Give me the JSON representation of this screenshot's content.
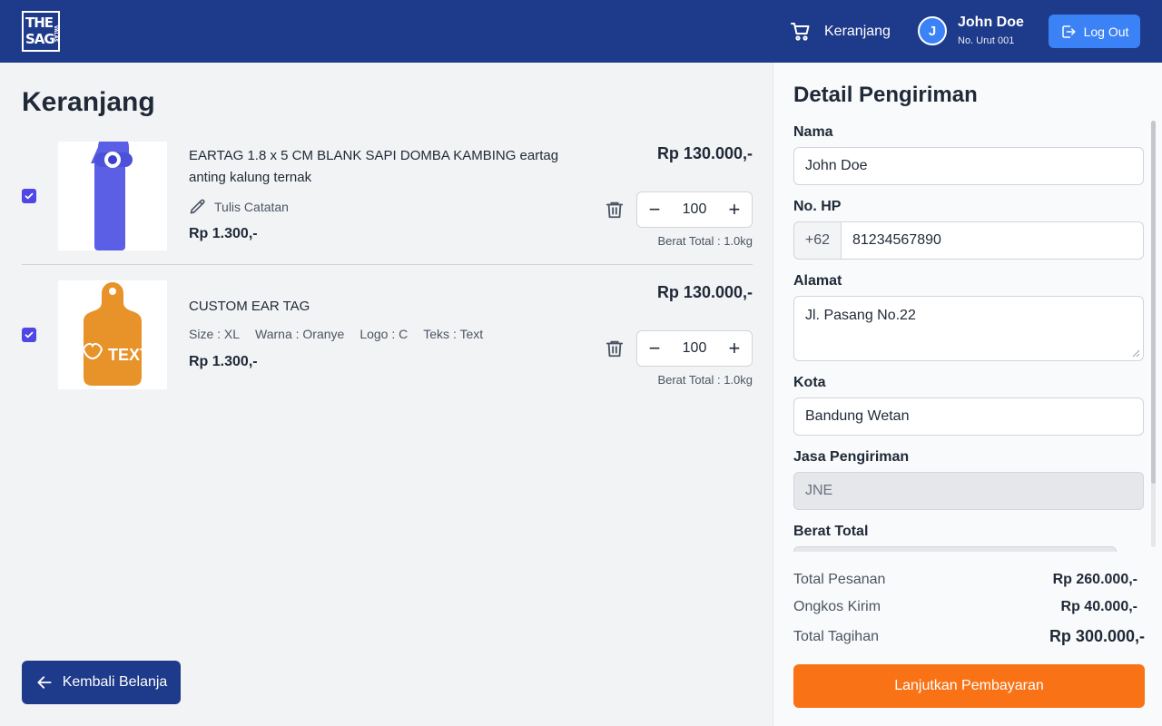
{
  "header": {
    "logo_line1": "THE",
    "logo_line2": "SAG",
    "logo_small": "VALAS",
    "cart_label": "Keranjang",
    "user_initial": "J",
    "user_name": "John Doe",
    "user_sub": "No. Urut 001",
    "logout_label": "Log Out"
  },
  "cart": {
    "title": "Keranjang",
    "items": [
      {
        "name": "EARTAG 1.8 x 5 CM BLANK SAPI DOMBA KAMBING eartag anting kalung ternak",
        "note_label": "Tulis Catatan",
        "unit_price": "Rp 1.300,-",
        "total_price": "Rp 130.000,-",
        "quantity": "100",
        "weight": "Berat Total : 1.0kg",
        "checked": true,
        "image_color": "#5b5fe6"
      },
      {
        "name": "CUSTOM EAR TAG",
        "variants": [
          "Size : XL",
          "Warna : Oranye",
          "Logo : C",
          "Teks : Text"
        ],
        "unit_price": "Rp 1.300,-",
        "total_price": "Rp 130.000,-",
        "quantity": "100",
        "weight": "Berat Total : 1.0kg",
        "checked": true,
        "image_color": "#e8922a",
        "image_text": "TEXT"
      }
    ],
    "back_label": "Kembali Belanja"
  },
  "shipping": {
    "title": "Detail Pengiriman",
    "name_label": "Nama",
    "name_value": "John Doe",
    "phone_label": "No. HP",
    "phone_prefix": "+62",
    "phone_value": "81234567890",
    "address_label": "Alamat",
    "address_value": "Jl. Pasang No.22",
    "city_label": "Kota",
    "city_value": "Bandung Wetan",
    "courier_label": "Jasa Pengiriman",
    "courier_value": "JNE",
    "weight_label": "Berat Total"
  },
  "summary": {
    "order_label": "Total Pesanan",
    "order_value": "Rp 260.000,-",
    "shipping_label": "Ongkos Kirim",
    "shipping_value": "Rp 40.000,-",
    "bill_label": "Total Tagihan",
    "bill_value": "Rp 300.000,-",
    "pay_label": "Lanjutkan Pembayaran"
  },
  "colors": {
    "header_bg": "#1e3a8a",
    "accent_blue": "#3b82f6",
    "pay_orange": "#f97316",
    "checkbox": "#4f46e5"
  }
}
